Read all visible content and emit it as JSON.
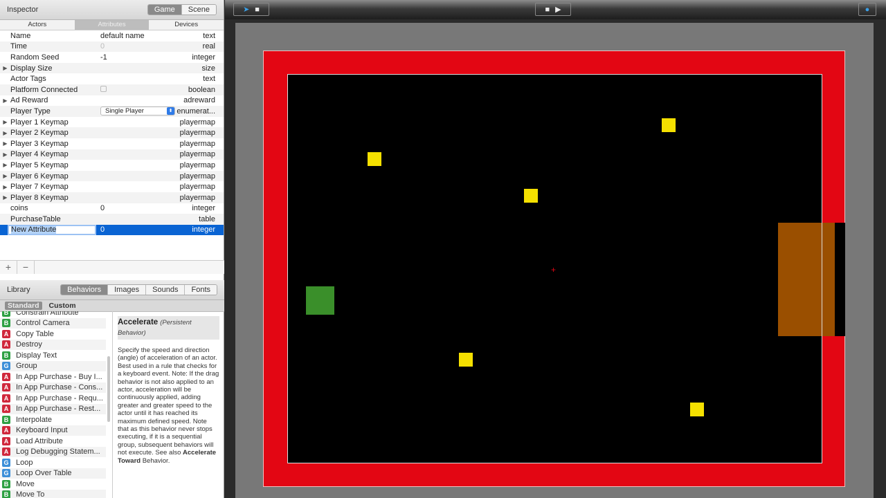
{
  "inspector": {
    "title": "Inspector",
    "modes": [
      "Game",
      "Scene"
    ],
    "active_mode": "Game",
    "tabs": [
      "Actors",
      "Attributes",
      "Devices"
    ],
    "active_tab": "Attributes",
    "rows": [
      {
        "name": "Name",
        "value": "default name",
        "type": "text"
      },
      {
        "name": "Time",
        "value": "0",
        "type": "real",
        "dim": true
      },
      {
        "name": "Random Seed",
        "value": "-1",
        "type": "integer"
      },
      {
        "name": "Display Size",
        "value": "",
        "type": "size",
        "expandable": true
      },
      {
        "name": "Actor Tags",
        "value": "",
        "type": "text"
      },
      {
        "name": "Platform Connected",
        "value": "",
        "type": "boolean",
        "checkbox": true
      },
      {
        "name": "Ad Reward",
        "value": "",
        "type": "adreward",
        "expandable": true
      },
      {
        "name": "Player Type",
        "value": "Single Player",
        "type": "enumerat...",
        "select": true
      },
      {
        "name": "Player 1 Keymap",
        "value": "",
        "type": "playermap",
        "expandable": true
      },
      {
        "name": "Player 2 Keymap",
        "value": "",
        "type": "playermap",
        "expandable": true
      },
      {
        "name": "Player 3 Keymap",
        "value": "",
        "type": "playermap",
        "expandable": true
      },
      {
        "name": "Player 4 Keymap",
        "value": "",
        "type": "playermap",
        "expandable": true
      },
      {
        "name": "Player 5 Keymap",
        "value": "",
        "type": "playermap",
        "expandable": true
      },
      {
        "name": "Player 6 Keymap",
        "value": "",
        "type": "playermap",
        "expandable": true
      },
      {
        "name": "Player 7 Keymap",
        "value": "",
        "type": "playermap",
        "expandable": true
      },
      {
        "name": "Player 8 Keymap",
        "value": "",
        "type": "playermap",
        "expandable": true
      },
      {
        "name": "coins",
        "value": "0",
        "type": "integer"
      },
      {
        "name": "PurchaseTable",
        "value": "",
        "type": "table"
      }
    ],
    "editing_row": {
      "name": "New Attribute",
      "value": "0",
      "type": "integer"
    },
    "add_label": "+",
    "remove_label": "−"
  },
  "library": {
    "title": "Library",
    "tabs": [
      "Behaviors",
      "Images",
      "Sounds",
      "Fonts"
    ],
    "active_tab": "Behaviors",
    "subtabs": [
      "Standard",
      "Custom"
    ],
    "active_subtab": "Standard",
    "behaviors": [
      {
        "badge": "B",
        "label": "Constrain Attribute"
      },
      {
        "badge": "B",
        "label": "Control Camera"
      },
      {
        "badge": "A",
        "label": "Copy Table"
      },
      {
        "badge": "A",
        "label": "Destroy"
      },
      {
        "badge": "B",
        "label": "Display Text"
      },
      {
        "badge": "G",
        "label": "Group"
      },
      {
        "badge": "A",
        "label": "In App Purchase - Buy I..."
      },
      {
        "badge": "A",
        "label": "In App Purchase - Cons..."
      },
      {
        "badge": "A",
        "label": "In App Purchase - Requ..."
      },
      {
        "badge": "A",
        "label": "In App Purchase - Rest..."
      },
      {
        "badge": "B",
        "label": "Interpolate"
      },
      {
        "badge": "A",
        "label": "Keyboard Input"
      },
      {
        "badge": "A",
        "label": "Load Attribute"
      },
      {
        "badge": "A",
        "label": "Log Debugging Statem..."
      },
      {
        "badge": "G",
        "label": "Loop"
      },
      {
        "badge": "G",
        "label": "Loop Over Table"
      },
      {
        "badge": "B",
        "label": "Move"
      },
      {
        "badge": "B",
        "label": "Move To"
      }
    ],
    "description": {
      "title": "Accelerate",
      "subtitle": "(Persistent Behavior)",
      "body": "Specify the speed and direction (angle) of acceleration of an actor. Best used in a rule that checks for a keyboard event. Note: If the drag behavior is not also applied to an actor, acceleration will be continuously applied, adding greater and greater speed to the actor until it has reached its maximum defined speed. Note that as this behavior never stops executing, if it is a sequential group, subsequent behaviors will not execute. See also",
      "link": "Accelerate Toward",
      "tail": "Behavior."
    }
  },
  "toolbar": {
    "left_icons": [
      "pointer-icon",
      "camera-icon"
    ],
    "center_icons": [
      "stop-icon",
      "play-icon"
    ],
    "right_icon": "preview-icon"
  },
  "colors": {
    "border": "#e30613",
    "floor": "#000000",
    "coin": "#f5e000",
    "player": "#3a8f2a",
    "door": "#9a4f00",
    "selection": "#0a64d3"
  }
}
